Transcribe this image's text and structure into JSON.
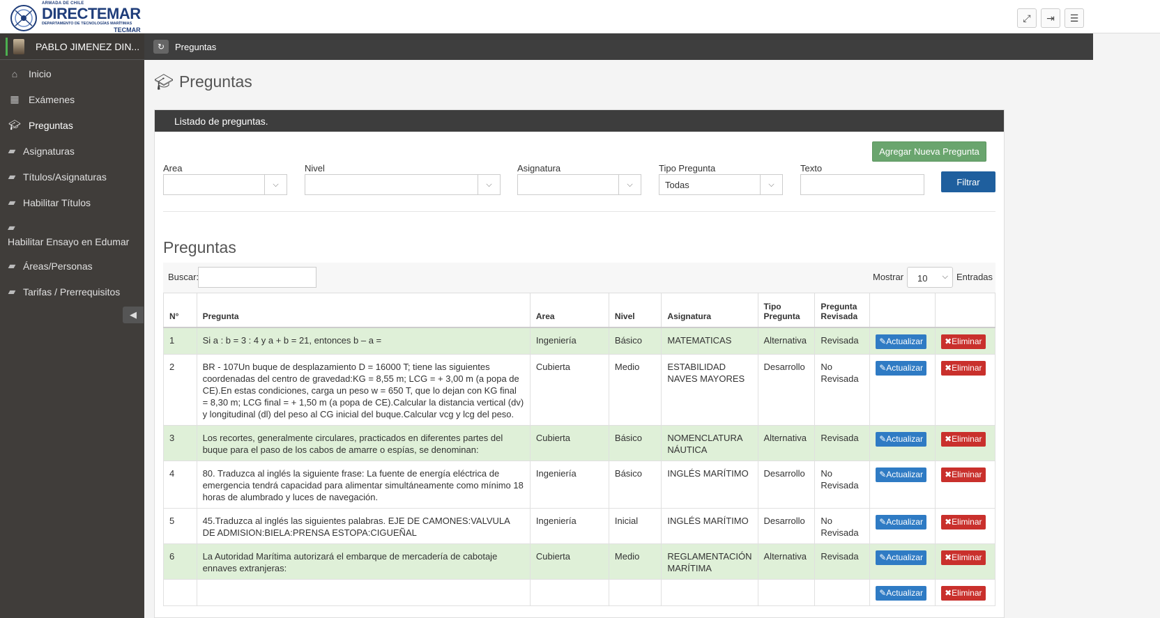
{
  "header": {
    "logo_small": "ARMADA DE CHILE",
    "logo_big": "DIRECTEMAR",
    "logo_dept": "DEPARTAMENTO DE TECNOLOGÍAS MARÍTIMAS",
    "logo_tec": "TECMAR",
    "buttons": [
      "fullscreen-icon",
      "logout-icon",
      "menu-icon"
    ]
  },
  "sidebar": {
    "user_name": "PABLO JIMENEZ DIN...",
    "items": [
      {
        "label": "Inicio",
        "icon": "home-icon"
      },
      {
        "label": "Exámenes",
        "icon": "calendar-icon"
      },
      {
        "label": "Preguntas",
        "icon": "graduation-cap-icon"
      },
      {
        "label": "Asignaturas",
        "icon": "book-icon"
      },
      {
        "label": "Títulos/Asignaturas",
        "icon": "book-icon"
      },
      {
        "label": "Habilitar Títulos",
        "icon": "book-icon"
      },
      {
        "label": "Habilitar Ensayo en Edumar",
        "icon": "book-icon"
      },
      {
        "label": "Áreas/Personas",
        "icon": "book-icon"
      },
      {
        "label": "Tarifas / Prerrequisitos",
        "icon": "book-icon"
      }
    ]
  },
  "breadcrumb": {
    "text": "Preguntas"
  },
  "page": {
    "title": "Preguntas"
  },
  "panel": {
    "heading": "Listado de preguntas.",
    "add_button": "Agregar Nueva Pregunta",
    "filters": {
      "area_label": "Area",
      "area_value": "",
      "nivel_label": "Nivel",
      "nivel_value": "",
      "asignatura_label": "Asignatura",
      "asignatura_value": "",
      "tipo_label": "Tipo Pregunta",
      "tipo_value": "Todas",
      "texto_label": "Texto",
      "texto_value": "",
      "filter_button": "Filtrar"
    },
    "subtitle": "Preguntas",
    "table_controls": {
      "search_label": "Buscar:",
      "show_label": "Mostrar",
      "show_value": "10",
      "entries_label": "Entradas"
    },
    "columns": [
      "N°",
      "Pregunta",
      "Area",
      "Nivel",
      "Asignatura",
      "Tipo Pregunta",
      "Pregunta Revisada",
      "",
      ""
    ],
    "update_label": "Actualizar",
    "delete_label": "Eliminar",
    "rows": [
      {
        "n": "1",
        "pregunta": "Si a : b = 3 : 4 y a + b = 21, entonces b – a =",
        "area": "Ingeniería",
        "nivel": "Básico",
        "asignatura": "MATEMATICAS",
        "tipo": "Alternativa",
        "revisada": "Revisada",
        "highlight": true
      },
      {
        "n": "2",
        "pregunta": "BR - 107Un buque de desplazamiento D = 16000 T; tiene las siguientes coordenadas del centro de gravedad:KG  =  8,55 m; LCG  =  + 3,00  m (a popa de CE).En estas condiciones, carga un peso w  =  650 T, que lo dejan con KG final = 8,30 m; LCG final  =  + 1,50 m (a popa de CE).Calcular la distancia vertical (dv) y longitudinal (dl) del peso al CG inicial del buque.Calcular vcg y lcg del peso.",
        "area": "Cubierta",
        "nivel": "Medio",
        "asignatura": "ESTABILIDAD NAVES MAYORES",
        "tipo": "Desarrollo",
        "revisada": "No Revisada",
        "highlight": false
      },
      {
        "n": "3",
        "pregunta": "Los recortes, generalmente circulares, practicados en diferentes partes del buque para el paso de los cabos de amarre o espías, se denominan:",
        "area": "Cubierta",
        "nivel": "Básico",
        "asignatura": "NOMENCLATURA NÁUTICA",
        "tipo": "Alternativa",
        "revisada": "Revisada",
        "highlight": true
      },
      {
        "n": "4",
        "pregunta": "80. Traduzca al inglés la siguiente frase: La fuente de energía eléctrica de emergencia tendrá capacidad para alimentar simultáneamente como mínimo 18 horas de alumbrado y luces de navegación.",
        "area": "Ingeniería",
        "nivel": "Básico",
        "asignatura": "INGLÉS MARÍTIMO",
        "tipo": "Desarrollo",
        "revisada": "No Revisada",
        "highlight": false
      },
      {
        "n": "5",
        "pregunta": "45.Traduzca al inglés las siguientes palabras. EJE DE CAMONES:VALVULA DE ADMISION:BIELA:PRENSA ESTOPA:CIGUEÑAL",
        "area": "Ingeniería",
        "nivel": "Inicial",
        "asignatura": "INGLÉS MARÍTIMO",
        "tipo": "Desarrollo",
        "revisada": "No Revisada",
        "highlight": false
      },
      {
        "n": "6",
        "pregunta": "La Autoridad Marítima autorizará el embarque de mercadería de cabotaje ennaves extranjeras:",
        "area": "Cubierta",
        "nivel": "Medio",
        "asignatura": "REGLAMENTACIÓN MARÍTIMA",
        "tipo": "Alternativa",
        "revisada": "Revisada",
        "highlight": true
      },
      {
        "n": "",
        "pregunta": "",
        "area": "",
        "nivel": "",
        "asignatura": "",
        "tipo": "",
        "revisada": "",
        "highlight": false
      }
    ]
  }
}
